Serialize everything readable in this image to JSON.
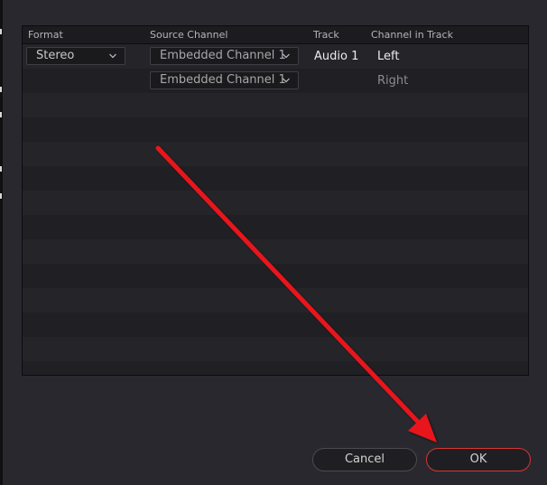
{
  "table": {
    "columns": [
      "Format",
      "Source Channel",
      "Track",
      "Channel in Track"
    ],
    "rows": [
      {
        "format": "Stereo",
        "source_channel": "Embedded Channel 1",
        "track": "Audio 1",
        "channel_in_track": "Left"
      },
      {
        "format": "",
        "source_channel": "Embedded Channel 1",
        "track": "",
        "channel_in_track": "Right"
      }
    ]
  },
  "buttons": {
    "cancel_label": "Cancel",
    "ok_label": "OK"
  },
  "colors": {
    "background": "#28282e",
    "ok_border": "#d8352f",
    "annotation_arrow": "#e8141a"
  },
  "annotation": {
    "arrow_icon": "red-arrow-pointing-to-ok"
  }
}
